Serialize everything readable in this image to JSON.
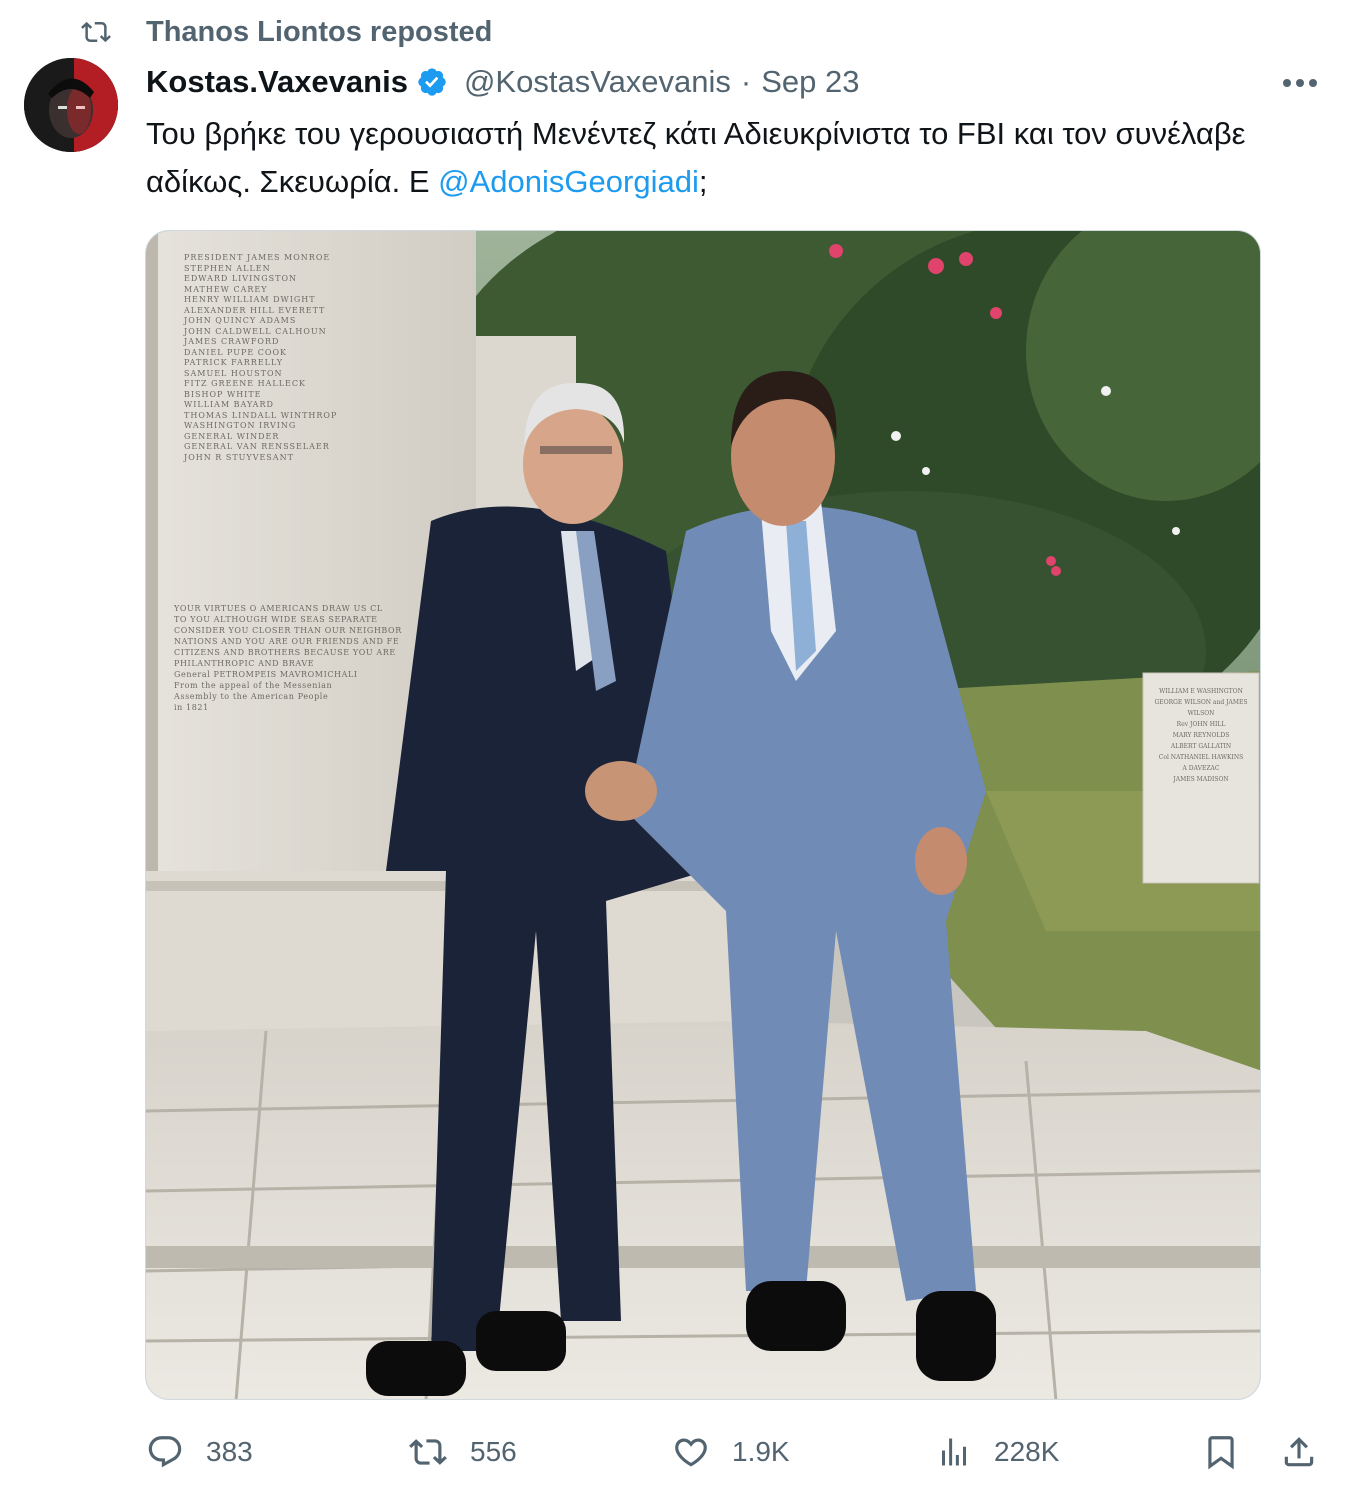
{
  "repost": {
    "text": "Thanos Liontos reposted",
    "icon": "repost-icon"
  },
  "author": {
    "display_name": "Kostas.Vaxevanis",
    "verified": true,
    "handle": "@KostasVaxevanis",
    "separator": "·",
    "date": "Sep 23"
  },
  "tweet": {
    "text_before": "Του βρήκε του γερουσιαστή Μενέντεζ κάτι Αδιευκρίνιστα το FBI και τον συνέλαβε αδίκως. Σκευωρία. Ε ",
    "mention": "@AdonisGeorgiadi",
    "text_after": ";"
  },
  "monument": {
    "names": [
      "PRESIDENT JAMES MONROE",
      "STEPHEN ALLEN",
      "EDWARD LIVINGSTON",
      "MATHEW CAREY",
      "HENRY WILLIAM DWIGHT",
      "ALEXANDER HILL EVERETT",
      "JOHN QUINCY ADAMS",
      "JOHN CALDWELL CALHOUN",
      "JAMES CRAWFORD",
      "DANIEL PUPE COOK",
      "PATRICK FARRELLY",
      "SAMUEL HOUSTON",
      "FITZ GREENE HALLECK",
      "BISHOP WHITE",
      "WILLIAM BAYARD",
      "THOMAS LINDALL WINTHROP",
      "WASHINGTON IRVING",
      "GENERAL WINDER",
      "GENERAL VAN RENSSELAER",
      "JOHN R STUYVESANT"
    ],
    "quote": [
      "YOUR VIRTUES O AMERICANS DRAW US CL",
      "TO YOU ALTHOUGH WIDE SEAS SEPARATE",
      "CONSIDER YOU CLOSER THAN OUR NEIGHBOR",
      "NATIONS AND YOU ARE OUR FRIENDS AND FE",
      "CITIZENS AND BROTHERS BECAUSE YOU ARE",
      "PHILANTHROPIC AND BRAVE",
      "General PETROMPEIS MAVROMICHALI",
      "From the appeal of the Messenian",
      "Assembly to the American People",
      "in 1821"
    ],
    "small_stone": [
      "WILLIAM E WASHINGTON",
      "GEORGE WILSON and JAMES WILSON",
      "Rev JOHN HILL",
      "MARY REYNOLDS",
      "ALBERT GALLATIN",
      "Col NATHANIEL HAWKINS",
      "A DAVEZAC",
      "JAMES MADISON"
    ]
  },
  "actions": {
    "reply": {
      "icon": "reply-icon",
      "count": "383"
    },
    "repost": {
      "icon": "repost-icon",
      "count": "556"
    },
    "like": {
      "icon": "heart-icon",
      "count": "1.9K"
    },
    "views": {
      "icon": "views-icon",
      "count": "228K"
    },
    "bookmark": {
      "icon": "bookmark-icon"
    },
    "share": {
      "icon": "share-icon"
    }
  },
  "colors": {
    "accent": "#1d9bf0",
    "secondary_text": "#536471",
    "primary_text": "#0f1419"
  }
}
